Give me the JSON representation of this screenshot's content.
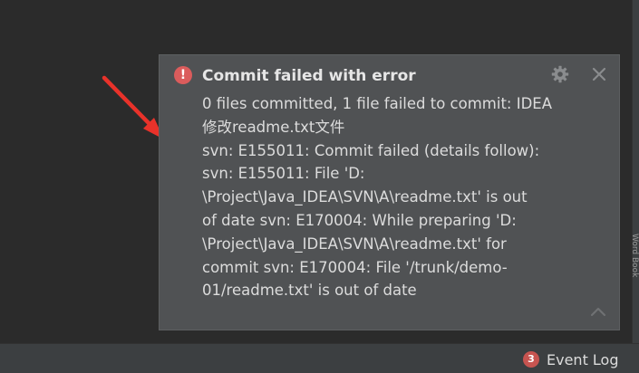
{
  "notification": {
    "title": "Commit failed with error",
    "message_lines": [
      "0 files committed, 1 file failed to commit: IDEA",
      "修改readme.txt文件",
      "svn: E155011: Commit failed (details follow):",
      "svn: E155011: File 'D:",
      "\\Project\\Java_IDEA\\SVN\\A\\readme.txt' is out",
      "of date svn: E170004: While preparing 'D:",
      "\\Project\\Java_IDEA\\SVN\\A\\readme.txt' for",
      "commit svn: E170004: File '/trunk/demo-",
      "01/readme.txt' is out of date"
    ],
    "icons": {
      "status": "error-icon",
      "settings": "gear-icon",
      "close": "close-icon",
      "collapse": "chevron-up-icon"
    },
    "error_glyph": "!"
  },
  "status_bar": {
    "event_log_count": "3",
    "event_log_label": "Event Log"
  },
  "side_tool_window_label": "Word Book",
  "colors": {
    "background": "#2b2b2b",
    "balloon_background": "#505254",
    "error_red": "#db5c5c",
    "badge_red": "#c75450",
    "annotation_arrow": "#e8322a"
  }
}
